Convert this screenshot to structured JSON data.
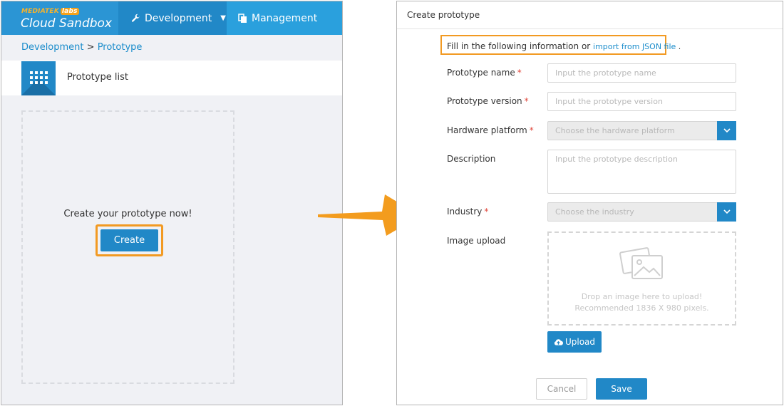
{
  "left": {
    "brand": {
      "company": "MEDIATEK",
      "labs": "labs",
      "product": "Cloud Sandbox"
    },
    "nav": {
      "development": "Development",
      "management": "Management"
    },
    "breadcrumb": {
      "first": "Development",
      "separator": " > ",
      "second": "Prototype"
    },
    "list_title": "Prototype list",
    "empty_prompt": "Create your prototype now!",
    "create_label": "Create"
  },
  "right": {
    "title": "Create prototype",
    "intro": "Fill in the following information or ",
    "import_link": "import from JSON file",
    "intro_end": " .",
    "fields": {
      "name": {
        "label": "Prototype name",
        "placeholder": "Input the prototype name"
      },
      "version": {
        "label": "Prototype version",
        "placeholder": "Input the prototype version"
      },
      "platform": {
        "label": "Hardware platform",
        "placeholder": "Choose the hardware platform"
      },
      "description": {
        "label": "Description",
        "placeholder": "Input the prototype description"
      },
      "industry": {
        "label": "Industry",
        "placeholder": "Choose the industry"
      },
      "image": {
        "label": "Image upload"
      }
    },
    "required_mark": "*",
    "drop_line1": "Drop an image here to upload!",
    "drop_line2": "Recommended 1836 X 980 pixels.",
    "upload_label": "Upload",
    "cancel_label": "Cancel",
    "save_label": "Save"
  },
  "colors": {
    "primary_blue": "#2188c7",
    "topbar_blue": "#2aa0dd",
    "highlight_orange": "#f29a22",
    "required_red": "#e0463a"
  },
  "icons": [
    "wrench-icon",
    "caret-down-icon",
    "document-icon",
    "grid-icon",
    "chevron-down-icon",
    "image-icon",
    "cloud-upload-icon",
    "arrow-right-icon"
  ]
}
